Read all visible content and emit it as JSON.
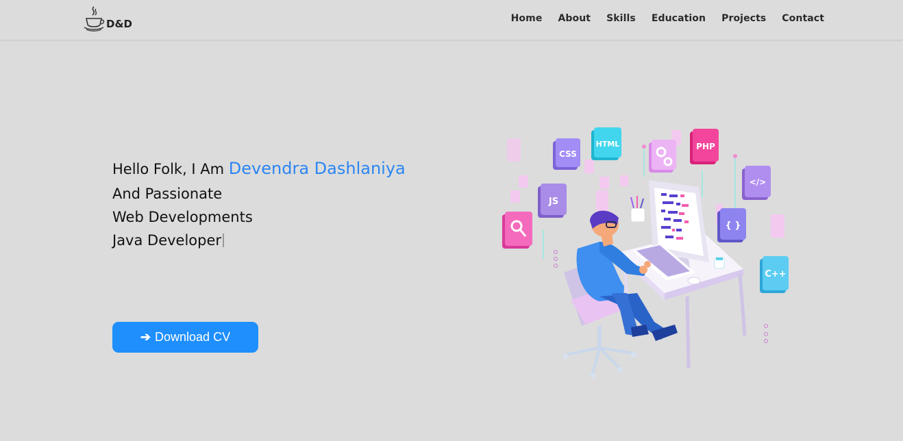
{
  "brand": {
    "logo_text": "D&D",
    "logo_icon": "java-cup-icon"
  },
  "nav": {
    "items": [
      {
        "label": "Home"
      },
      {
        "label": "About"
      },
      {
        "label": "Skills"
      },
      {
        "label": "Education"
      },
      {
        "label": "Projects"
      },
      {
        "label": "Contact"
      }
    ]
  },
  "hero": {
    "greeting": "Hello Folk, I Am ",
    "name": "Devendra Dashlaniya",
    "line2": "And Passionate",
    "line3": "Web Developments",
    "line4": "Java Developer",
    "cta_label": "Download CV",
    "cta_icon": "arrow-right-icon"
  },
  "illustration": {
    "tiles": [
      "CSS",
      "HTML",
      "PHP",
      "</>",
      "JS",
      "{ }",
      "C++"
    ]
  },
  "colors": {
    "background": "#dcdcdc",
    "accent": "#2b86f2",
    "button": "#1e8ffd"
  }
}
